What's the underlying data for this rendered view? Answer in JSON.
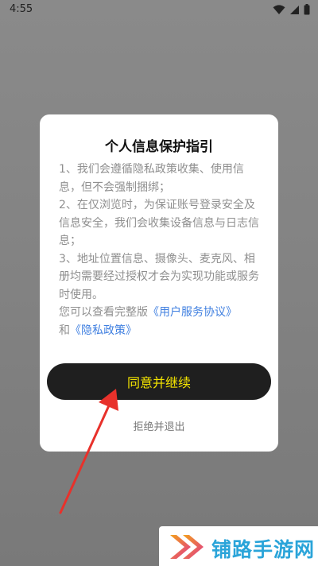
{
  "status_bar": {
    "time": "4:55",
    "icons": [
      "wifi-icon",
      "signal-icon",
      "battery-icon"
    ]
  },
  "dialog": {
    "title": "个人信息保护指引",
    "paragraphs": [
      "1、我们会遵循隐私政策收集、使用信息，但不会强制捆绑；",
      "2、在仅浏览时，为保证账号登录安全及信息安全，我们会收集设备信息与日志信息；",
      "3、地址位置信息、摄像头、麦克风、相册均需要经过授权才会为实现功能或服务时使用。"
    ],
    "notice_prefix": "您可以查看完整版",
    "user_agreement_link": "《用户服务协议》",
    "notice_and": "和",
    "privacy_policy_link": "《隐私政策》",
    "agree_button": "同意并继续",
    "reject_link": "拒绝并退出"
  },
  "watermark": {
    "text": "铺路手游网",
    "logo_icon": "double-chevron-logo-icon"
  },
  "colors": {
    "agree_button_bg": "#1f1f1f",
    "agree_button_text": "#f5e600",
    "link": "#3f7fe0",
    "annotation_arrow": "#e8312b",
    "watermark_text": "#2aa4d9"
  }
}
